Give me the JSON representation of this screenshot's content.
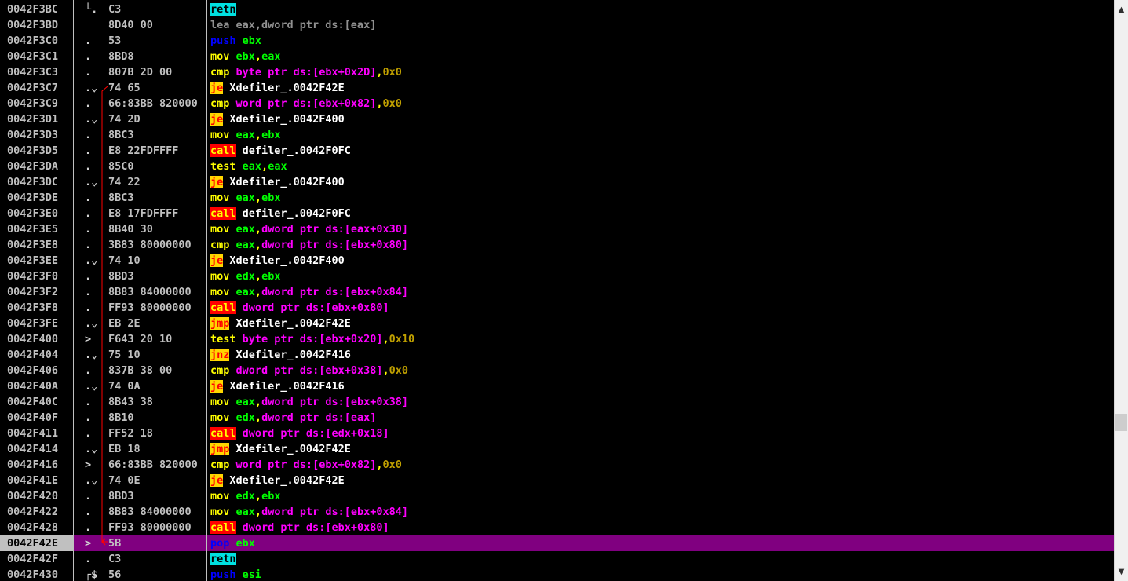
{
  "window": {
    "columns": [
      "address",
      "hex_dump",
      "disassembly",
      "comment"
    ]
  },
  "scrollbar": {
    "up_arrow": "▲",
    "down_arrow": "▼",
    "position": 0.72
  },
  "colors": {
    "background": "#000000",
    "selected_row": "#800080",
    "mnemonic": "#ffff00",
    "register": "#00ff00",
    "memory": "#ff00ff",
    "immediate": "#c0a000",
    "call_badge": "#ff0000",
    "jump_badge": "#ffd700",
    "retn_badge": "#00e0e0",
    "stack_op": "#0000ff"
  },
  "rows": [
    {
      "addr": "0042F3BC",
      "mark": "└.",
      "hex": "C3",
      "dis": [
        [
          "retn",
          "retn"
        ]
      ]
    },
    {
      "addr": "0042F3BD",
      "mark": "",
      "hex": "8D40 00",
      "dis": [
        [
          "dim",
          "lea eax,dword ptr ds:[eax]"
        ]
      ]
    },
    {
      "addr": "0042F3C0",
      "mark": ".",
      "hex": "53",
      "dis": [
        [
          "stack",
          "push"
        ],
        [
          "txt",
          " "
        ],
        [
          "reg",
          "ebx"
        ]
      ]
    },
    {
      "addr": "0042F3C1",
      "mark": ".",
      "hex": "8BD8",
      "dis": [
        [
          "mnem",
          "mov"
        ],
        [
          "txt",
          " "
        ],
        [
          "reg",
          "ebx"
        ],
        [
          "mnem",
          ","
        ],
        [
          "reg",
          "eax"
        ]
      ]
    },
    {
      "addr": "0042F3C3",
      "mark": ".",
      "hex": "807B 2D 00",
      "dis": [
        [
          "mnem",
          "cmp"
        ],
        [
          "txt",
          " "
        ],
        [
          "mem",
          "byte ptr ds:[ebx+0x2D]"
        ],
        [
          "mnem",
          ","
        ],
        [
          "num",
          "0x0"
        ]
      ]
    },
    {
      "addr": "0042F3C7",
      "mark": ".⌄",
      "hex": "74 65",
      "dis": [
        [
          "jcc",
          "je"
        ],
        [
          "txt",
          " "
        ],
        [
          "lbl",
          "Xdefiler_.0042F42E"
        ]
      ]
    },
    {
      "addr": "0042F3C9",
      "mark": ".",
      "hex": "66:83BB 820000",
      "dis": [
        [
          "mnem",
          "cmp"
        ],
        [
          "txt",
          " "
        ],
        [
          "mem",
          "word ptr ds:[ebx+0x82]"
        ],
        [
          "mnem",
          ","
        ],
        [
          "num",
          "0x0"
        ]
      ]
    },
    {
      "addr": "0042F3D1",
      "mark": ".⌄",
      "hex": "74 2D",
      "dis": [
        [
          "jcc",
          "je"
        ],
        [
          "txt",
          " "
        ],
        [
          "lbl",
          "Xdefiler_.0042F400"
        ]
      ]
    },
    {
      "addr": "0042F3D3",
      "mark": ".",
      "hex": "8BC3",
      "dis": [
        [
          "mnem",
          "mov"
        ],
        [
          "txt",
          " "
        ],
        [
          "reg",
          "eax"
        ],
        [
          "mnem",
          ","
        ],
        [
          "reg",
          "ebx"
        ]
      ]
    },
    {
      "addr": "0042F3D5",
      "mark": ".",
      "hex": "E8 22FDFFFF",
      "dis": [
        [
          "call",
          "call"
        ],
        [
          "txt",
          " "
        ],
        [
          "lbl",
          "defiler_.0042F0FC"
        ]
      ]
    },
    {
      "addr": "0042F3DA",
      "mark": ".",
      "hex": "85C0",
      "dis": [
        [
          "mnem",
          "test"
        ],
        [
          "txt",
          " "
        ],
        [
          "reg",
          "eax"
        ],
        [
          "mnem",
          ","
        ],
        [
          "reg",
          "eax"
        ]
      ]
    },
    {
      "addr": "0042F3DC",
      "mark": ".⌄",
      "hex": "74 22",
      "dis": [
        [
          "jcc",
          "je"
        ],
        [
          "txt",
          " "
        ],
        [
          "lbl",
          "Xdefiler_.0042F400"
        ]
      ]
    },
    {
      "addr": "0042F3DE",
      "mark": ".",
      "hex": "8BC3",
      "dis": [
        [
          "mnem",
          "mov"
        ],
        [
          "txt",
          " "
        ],
        [
          "reg",
          "eax"
        ],
        [
          "mnem",
          ","
        ],
        [
          "reg",
          "ebx"
        ]
      ]
    },
    {
      "addr": "0042F3E0",
      "mark": ".",
      "hex": "E8 17FDFFFF",
      "dis": [
        [
          "call",
          "call"
        ],
        [
          "txt",
          " "
        ],
        [
          "lbl",
          "defiler_.0042F0FC"
        ]
      ]
    },
    {
      "addr": "0042F3E5",
      "mark": ".",
      "hex": "8B40 30",
      "dis": [
        [
          "mnem",
          "mov"
        ],
        [
          "txt",
          " "
        ],
        [
          "reg",
          "eax"
        ],
        [
          "mnem",
          ","
        ],
        [
          "mem",
          "dword ptr ds:[eax+0x30]"
        ]
      ]
    },
    {
      "addr": "0042F3E8",
      "mark": ".",
      "hex": "3B83 80000000",
      "dis": [
        [
          "mnem",
          "cmp"
        ],
        [
          "txt",
          " "
        ],
        [
          "reg",
          "eax"
        ],
        [
          "mnem",
          ","
        ],
        [
          "mem",
          "dword ptr ds:[ebx+0x80]"
        ]
      ]
    },
    {
      "addr": "0042F3EE",
      "mark": ".⌄",
      "hex": "74 10",
      "dis": [
        [
          "jcc",
          "je"
        ],
        [
          "txt",
          " "
        ],
        [
          "lbl",
          "Xdefiler_.0042F400"
        ]
      ]
    },
    {
      "addr": "0042F3F0",
      "mark": ".",
      "hex": "8BD3",
      "dis": [
        [
          "mnem",
          "mov"
        ],
        [
          "txt",
          " "
        ],
        [
          "reg",
          "edx"
        ],
        [
          "mnem",
          ","
        ],
        [
          "reg",
          "ebx"
        ]
      ]
    },
    {
      "addr": "0042F3F2",
      "mark": ".",
      "hex": "8B83 84000000",
      "dis": [
        [
          "mnem",
          "mov"
        ],
        [
          "txt",
          " "
        ],
        [
          "reg",
          "eax"
        ],
        [
          "mnem",
          ","
        ],
        [
          "mem",
          "dword ptr ds:[ebx+0x84]"
        ]
      ]
    },
    {
      "addr": "0042F3F8",
      "mark": ".",
      "hex": "FF93 80000000",
      "dis": [
        [
          "call",
          "call"
        ],
        [
          "txt",
          " "
        ],
        [
          "mem",
          "dword ptr ds:[ebx+0x80]"
        ]
      ]
    },
    {
      "addr": "0042F3FE",
      "mark": ".⌄",
      "hex": "EB 2E",
      "dis": [
        [
          "jmp",
          "jmp"
        ],
        [
          "txt",
          " "
        ],
        [
          "lbl",
          "Xdefiler_.0042F42E"
        ]
      ]
    },
    {
      "addr": "0042F400",
      "mark": ">",
      "hex": "F643 20 10",
      "dis": [
        [
          "mnem",
          "test"
        ],
        [
          "txt",
          " "
        ],
        [
          "mem",
          "byte ptr ds:[ebx+0x20]"
        ],
        [
          "mnem",
          ","
        ],
        [
          "num",
          "0x10"
        ]
      ]
    },
    {
      "addr": "0042F404",
      "mark": ".⌄",
      "hex": "75 10",
      "dis": [
        [
          "jcc",
          "jnz"
        ],
        [
          "txt",
          " "
        ],
        [
          "lbl",
          "Xdefiler_.0042F416"
        ]
      ]
    },
    {
      "addr": "0042F406",
      "mark": ".",
      "hex": "837B 38 00",
      "dis": [
        [
          "mnem",
          "cmp"
        ],
        [
          "txt",
          " "
        ],
        [
          "mem",
          "dword ptr ds:[ebx+0x38]"
        ],
        [
          "mnem",
          ","
        ],
        [
          "num",
          "0x0"
        ]
      ]
    },
    {
      "addr": "0042F40A",
      "mark": ".⌄",
      "hex": "74 0A",
      "dis": [
        [
          "jcc",
          "je"
        ],
        [
          "txt",
          " "
        ],
        [
          "lbl",
          "Xdefiler_.0042F416"
        ]
      ]
    },
    {
      "addr": "0042F40C",
      "mark": ".",
      "hex": "8B43 38",
      "dis": [
        [
          "mnem",
          "mov"
        ],
        [
          "txt",
          " "
        ],
        [
          "reg",
          "eax"
        ],
        [
          "mnem",
          ","
        ],
        [
          "mem",
          "dword ptr ds:[ebx+0x38]"
        ]
      ]
    },
    {
      "addr": "0042F40F",
      "mark": ".",
      "hex": "8B10",
      "dis": [
        [
          "mnem",
          "mov"
        ],
        [
          "txt",
          " "
        ],
        [
          "reg",
          "edx"
        ],
        [
          "mnem",
          ","
        ],
        [
          "mem",
          "dword ptr ds:[eax]"
        ]
      ]
    },
    {
      "addr": "0042F411",
      "mark": ".",
      "hex": "FF52 18",
      "dis": [
        [
          "call",
          "call"
        ],
        [
          "txt",
          " "
        ],
        [
          "mem",
          "dword ptr ds:[edx+0x18]"
        ]
      ]
    },
    {
      "addr": "0042F414",
      "mark": ".⌄",
      "hex": "EB 18",
      "dis": [
        [
          "jmp",
          "jmp"
        ],
        [
          "txt",
          " "
        ],
        [
          "lbl",
          "Xdefiler_.0042F42E"
        ]
      ]
    },
    {
      "addr": "0042F416",
      "mark": ">",
      "hex": "66:83BB 820000",
      "dis": [
        [
          "mnem",
          "cmp"
        ],
        [
          "txt",
          " "
        ],
        [
          "mem",
          "word ptr ds:[ebx+0x82]"
        ],
        [
          "mnem",
          ","
        ],
        [
          "num",
          "0x0"
        ]
      ]
    },
    {
      "addr": "0042F41E",
      "mark": ".⌄",
      "hex": "74 0E",
      "dis": [
        [
          "jcc",
          "je"
        ],
        [
          "txt",
          " "
        ],
        [
          "lbl",
          "Xdefiler_.0042F42E"
        ]
      ]
    },
    {
      "addr": "0042F420",
      "mark": ".",
      "hex": "8BD3",
      "dis": [
        [
          "mnem",
          "mov"
        ],
        [
          "txt",
          " "
        ],
        [
          "reg",
          "edx"
        ],
        [
          "mnem",
          ","
        ],
        [
          "reg",
          "ebx"
        ]
      ]
    },
    {
      "addr": "0042F422",
      "mark": ".",
      "hex": "8B83 84000000",
      "dis": [
        [
          "mnem",
          "mov"
        ],
        [
          "txt",
          " "
        ],
        [
          "reg",
          "eax"
        ],
        [
          "mnem",
          ","
        ],
        [
          "mem",
          "dword ptr ds:[ebx+0x84]"
        ]
      ]
    },
    {
      "addr": "0042F428",
      "mark": ".",
      "hex": "FF93 80000000",
      "dis": [
        [
          "call",
          "call"
        ],
        [
          "txt",
          " "
        ],
        [
          "mem",
          "dword ptr ds:[ebx+0x80]"
        ]
      ]
    },
    {
      "addr": "0042F42E",
      "mark": ">",
      "hex": "5B",
      "selected": true,
      "dis": [
        [
          "stack",
          "pop"
        ],
        [
          "txt",
          " "
        ],
        [
          "reg",
          "ebx"
        ]
      ]
    },
    {
      "addr": "0042F42F",
      "mark": ".",
      "hex": "C3",
      "dis": [
        [
          "retn",
          "retn"
        ]
      ]
    },
    {
      "addr": "0042F430",
      "mark": "┌$",
      "hex": "56",
      "dis": [
        [
          "stack",
          "push"
        ],
        [
          "txt",
          " "
        ],
        [
          "reg",
          "esi"
        ]
      ]
    }
  ]
}
